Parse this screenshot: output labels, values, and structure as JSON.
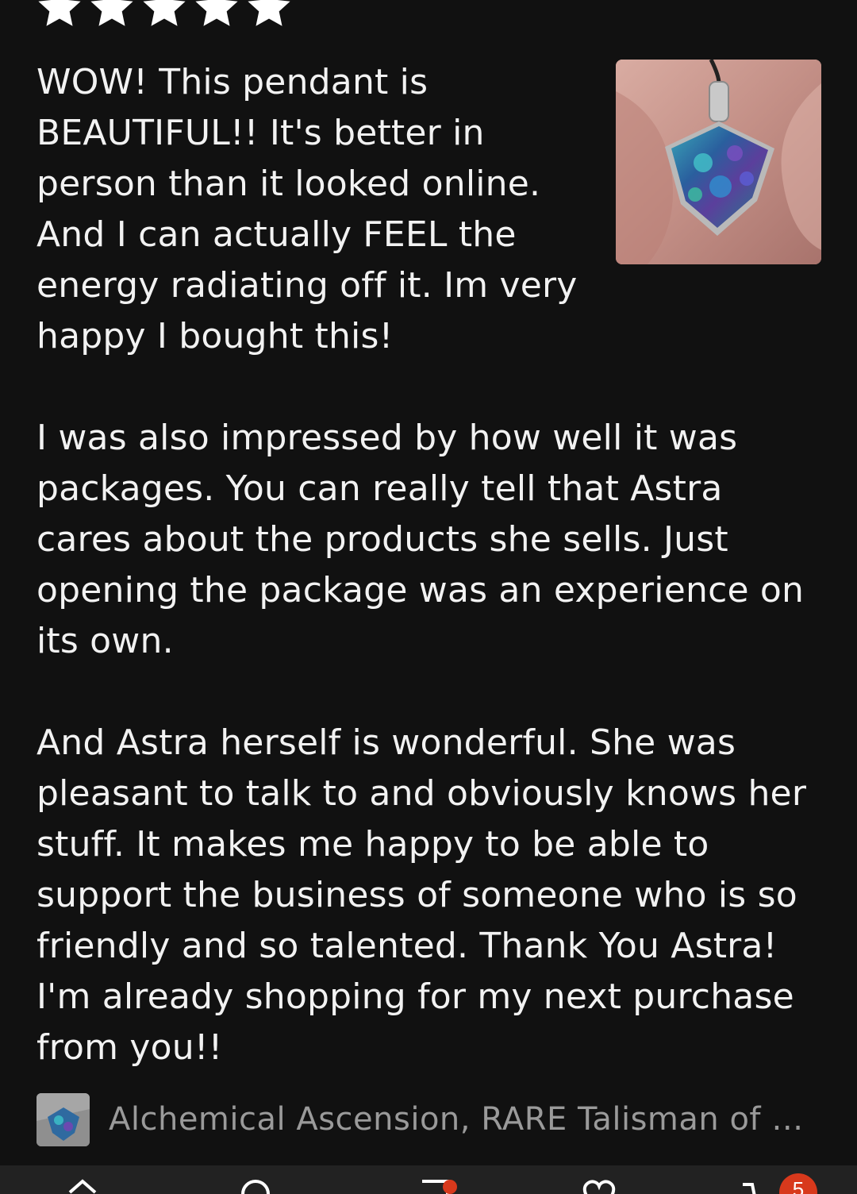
{
  "review": {
    "rating": 5,
    "max_rating": 5,
    "paragraph_1": "WOW! This pendant is BEAUTIFUL!! It's better in person than it looked online. And I can actually FEEL the energy radiating off it. Im very happy I bought this!",
    "paragraph_2": "I was also impressed by how well it was packages. You can really tell that Astra cares about the products she sells. Just opening the package was an experience on its own.",
    "paragraph_3": "And Astra herself is wonderful. She was pleasant to talk to and obviously knows her stuff. It makes me happy to be able to support the business of someone who is so friendly and so talented. Thank You Astra! I'm already shopping for my next purchase from you!!"
  },
  "item": {
    "title": "Alchemical Ascension, RARE Talisman of I..."
  },
  "bottom_nav": {
    "items": [
      {
        "icon": "home-icon"
      },
      {
        "icon": "search-icon"
      },
      {
        "icon": "notifications-icon"
      },
      {
        "icon": "favorites-icon"
      },
      {
        "icon": "cart-icon"
      }
    ],
    "cart_count": "5"
  },
  "colors": {
    "background": "#111111",
    "text": "#f2f2f2",
    "muted_text": "#9a9a9a",
    "nav_background": "#222222",
    "badge": "#d8391c"
  }
}
